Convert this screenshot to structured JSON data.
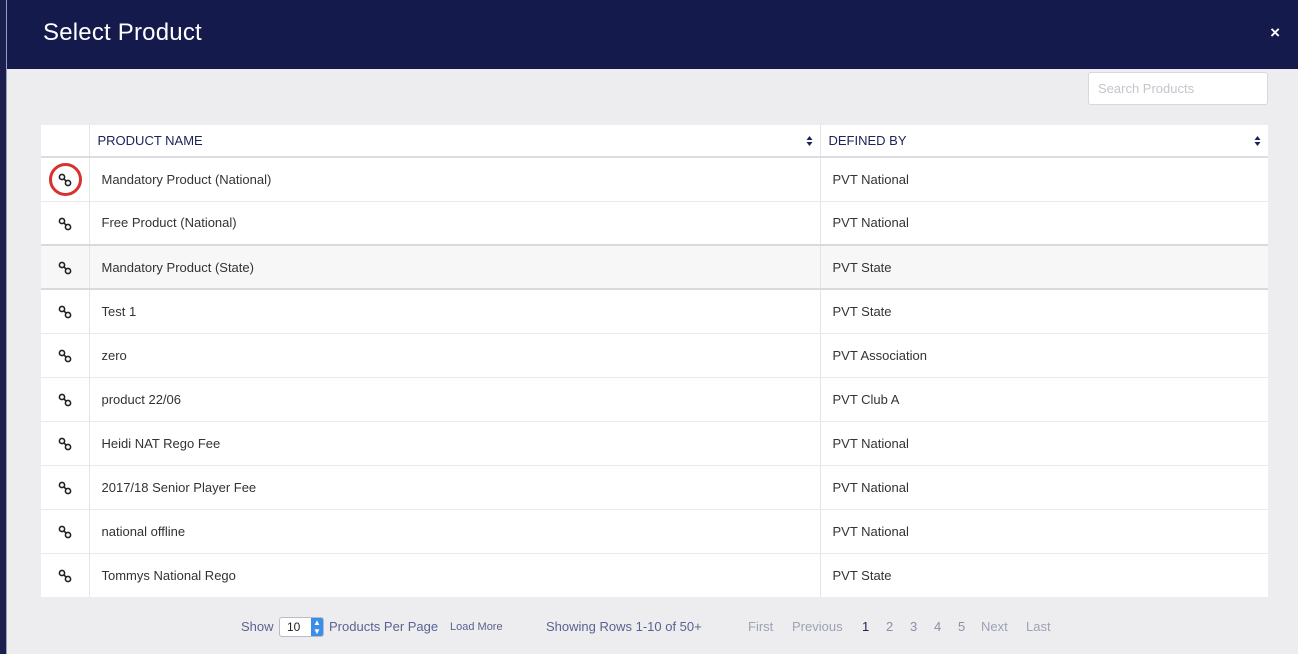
{
  "modal": {
    "title": "Select Product",
    "close_label": "×"
  },
  "search": {
    "placeholder": "Search Products",
    "value": ""
  },
  "table": {
    "columns": [
      "PRODUCT NAME",
      "DEFINED BY"
    ],
    "rows": [
      {
        "name": "Mandatory Product (National)",
        "defined_by": "PVT National"
      },
      {
        "name": "Free Product (National)",
        "defined_by": "PVT National"
      },
      {
        "name": "Mandatory Product (State)",
        "defined_by": "PVT State"
      },
      {
        "name": "Test 1",
        "defined_by": "PVT State"
      },
      {
        "name": "zero",
        "defined_by": "PVT Association"
      },
      {
        "name": "product 22/06",
        "defined_by": "PVT Club A"
      },
      {
        "name": "Heidi NAT Rego Fee",
        "defined_by": "PVT National"
      },
      {
        "name": "2017/18 Senior Player Fee",
        "defined_by": "PVT National"
      },
      {
        "name": "national offline",
        "defined_by": "PVT National"
      },
      {
        "name": "Tommys National Rego",
        "defined_by": "PVT State"
      }
    ],
    "row_icon": "link-icon"
  },
  "footer": {
    "show_label": "Show",
    "per_page_value": "10",
    "per_page_label": "Products Per Page",
    "load_more": "Load More",
    "showing": "Showing Rows 1-10 of 50+",
    "pagination": {
      "first": "First",
      "previous": "Previous",
      "pages": [
        "1",
        "2",
        "3",
        "4",
        "5"
      ],
      "next": "Next",
      "last": "Last"
    }
  },
  "colors": {
    "header_bg": "#151a4c",
    "highlight_ring": "#d6322f",
    "select_arrow": "#3b8ee8"
  }
}
